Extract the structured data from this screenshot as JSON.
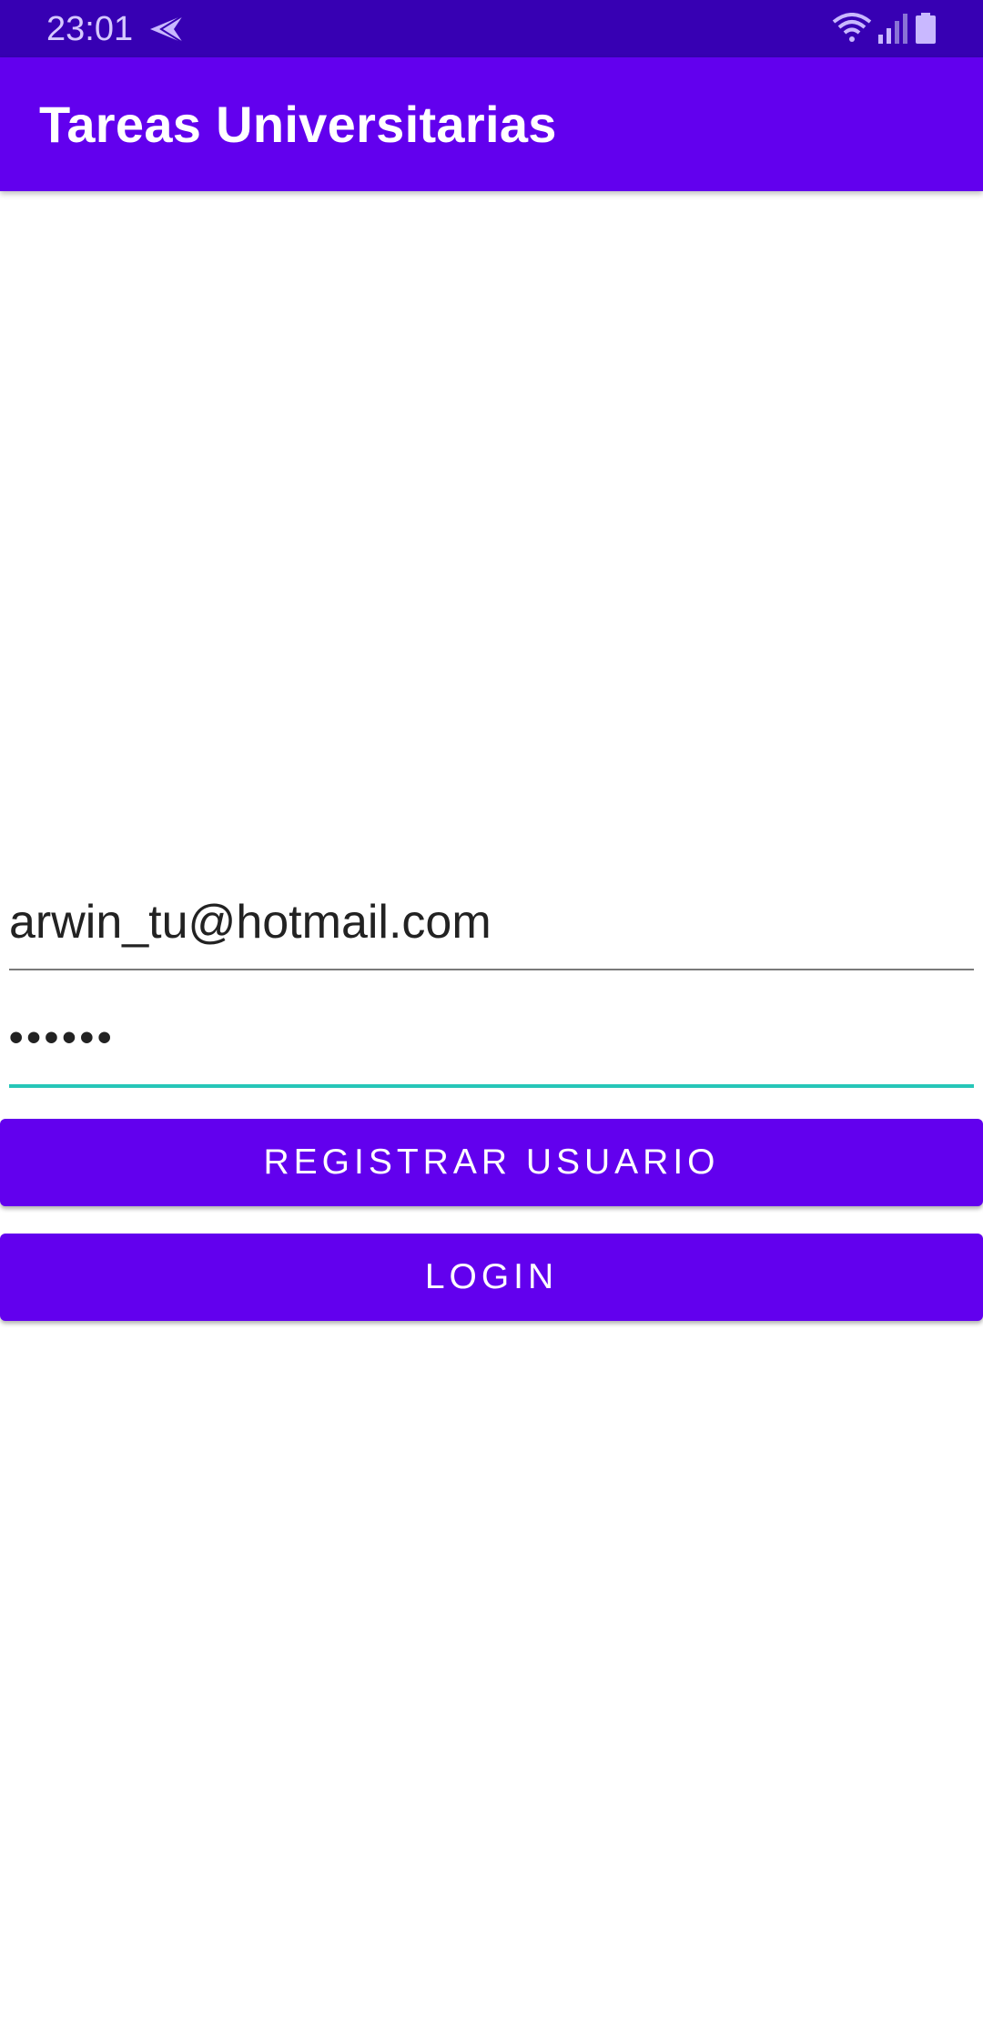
{
  "status_bar": {
    "time": "23:01",
    "icons": [
      "navigation-send-icon",
      "wifi-icon",
      "signal-icon",
      "battery-icon"
    ],
    "background": "#3700b3"
  },
  "app_bar": {
    "title": "Tareas Universitarias",
    "background": "#6200ee"
  },
  "form": {
    "email_value": "arwin_tu@hotmail.com",
    "password_value": "123456",
    "accent_color": "#26c6b8"
  },
  "buttons": {
    "register_label": "REGISTRAR USUARIO",
    "login_label": "LOGIN",
    "background": "#6200ee"
  }
}
